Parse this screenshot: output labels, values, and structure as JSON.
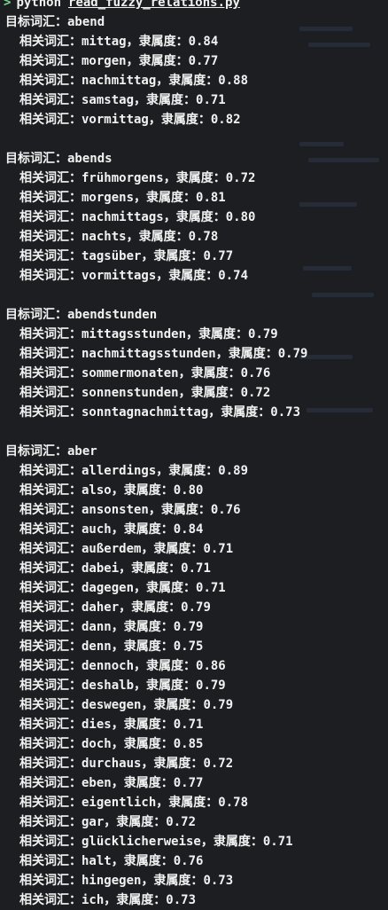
{
  "command": {
    "prompt": ">",
    "program": "python",
    "script": "read_fuzzy_relations.py"
  },
  "labels": {
    "target": "目标词汇：",
    "related": "相关词汇：",
    "degree": "，隶属度："
  },
  "groups": [
    {
      "word": "abend",
      "related": [
        {
          "word": "mittag",
          "score": "0.84"
        },
        {
          "word": "morgen",
          "score": "0.77"
        },
        {
          "word": "nachmittag",
          "score": "0.88"
        },
        {
          "word": "samstag",
          "score": "0.71"
        },
        {
          "word": "vormittag",
          "score": "0.82"
        }
      ]
    },
    {
      "word": "abends",
      "related": [
        {
          "word": "frühmorgens",
          "score": "0.72"
        },
        {
          "word": "morgens",
          "score": "0.81"
        },
        {
          "word": "nachmittags",
          "score": "0.80"
        },
        {
          "word": "nachts",
          "score": "0.78"
        },
        {
          "word": "tagsüber",
          "score": "0.77"
        },
        {
          "word": "vormittags",
          "score": "0.74"
        }
      ]
    },
    {
      "word": "abendstunden",
      "related": [
        {
          "word": "mittagsstunden",
          "score": "0.79"
        },
        {
          "word": "nachmittagsstunden",
          "score": "0.79"
        },
        {
          "word": "sommermonaten",
          "score": "0.76"
        },
        {
          "word": "sonnenstunden",
          "score": "0.72"
        },
        {
          "word": "sonntagnachmittag",
          "score": "0.73"
        }
      ]
    },
    {
      "word": "aber",
      "related": [
        {
          "word": "allerdings",
          "score": "0.89"
        },
        {
          "word": "also",
          "score": "0.80"
        },
        {
          "word": "ansonsten",
          "score": "0.76"
        },
        {
          "word": "auch",
          "score": "0.84"
        },
        {
          "word": "außerdem",
          "score": "0.71"
        },
        {
          "word": "dabei",
          "score": "0.71"
        },
        {
          "word": "dagegen",
          "score": "0.71"
        },
        {
          "word": "daher",
          "score": "0.79"
        },
        {
          "word": "dann",
          "score": "0.79"
        },
        {
          "word": "denn",
          "score": "0.75"
        },
        {
          "word": "dennoch",
          "score": "0.86"
        },
        {
          "word": "deshalb",
          "score": "0.79"
        },
        {
          "word": "deswegen",
          "score": "0.79"
        },
        {
          "word": "dies",
          "score": "0.71"
        },
        {
          "word": "doch",
          "score": "0.85"
        },
        {
          "word": "durchaus",
          "score": "0.72"
        },
        {
          "word": "eben",
          "score": "0.77"
        },
        {
          "word": "eigentlich",
          "score": "0.78"
        },
        {
          "word": "gar",
          "score": "0.72"
        },
        {
          "word": "glücklicherweise",
          "score": "0.71"
        },
        {
          "word": "halt",
          "score": "0.76"
        },
        {
          "word": "hingegen",
          "score": "0.73"
        },
        {
          "word": "ich",
          "score": "0.73"
        }
      ]
    }
  ]
}
